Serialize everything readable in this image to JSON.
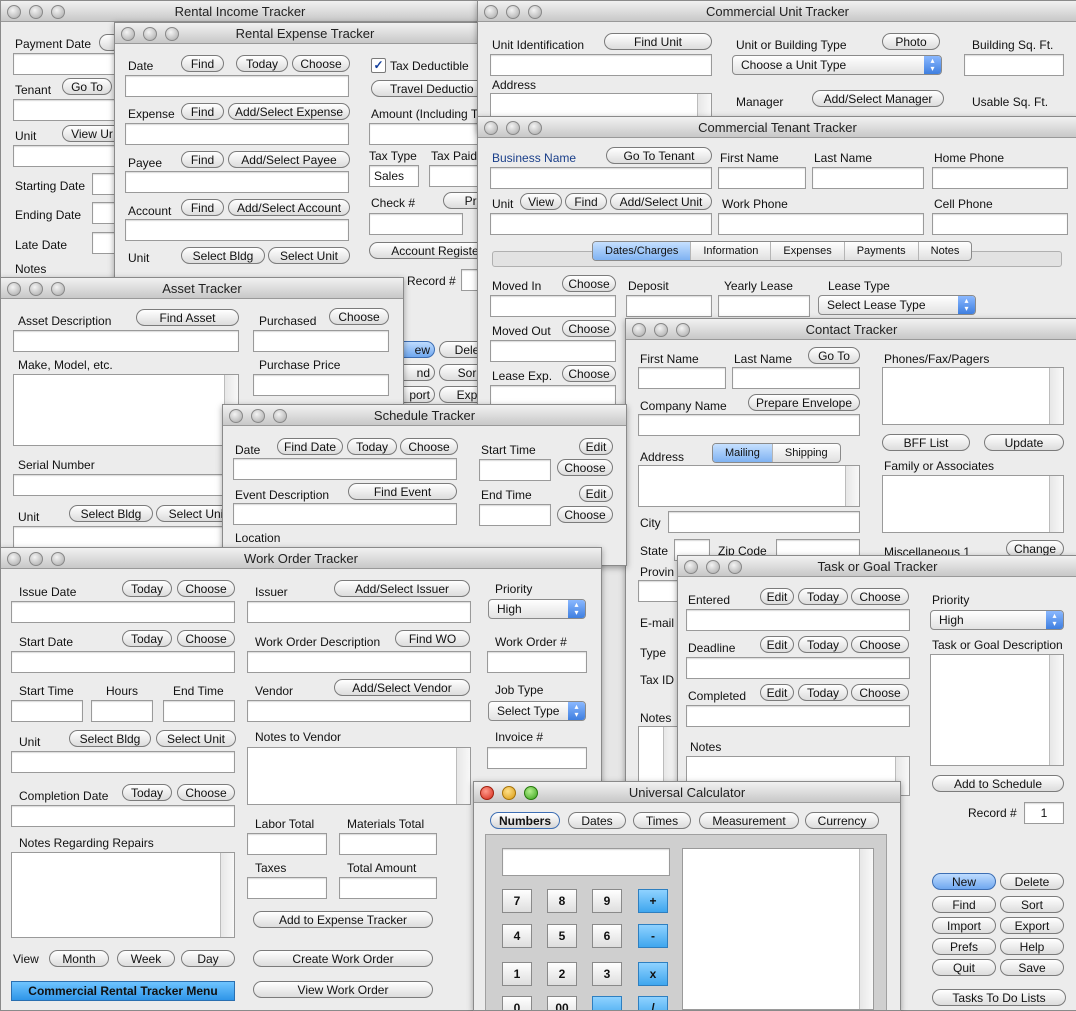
{
  "rental_income": {
    "title": "Rental Income Tracker",
    "payment_date": "Payment Date",
    "tenant": "Tenant",
    "go_to": "Go To",
    "unit": "Unit",
    "view_unit": "View Ur",
    "starting_date": "Starting Date",
    "ending_date": "Ending Date",
    "late_date": "Late Date",
    "notes": "Notes"
  },
  "rental_expense": {
    "title": "Rental Expense Tracker",
    "date": "Date",
    "find": "Find",
    "today": "Today",
    "choose": "Choose",
    "tax_deductible": "Tax Deductible",
    "travel_deduction": "Travel Deductio",
    "expense": "Expense",
    "add_select_expense": "Add/Select Expense",
    "amount": "Amount (Including T",
    "payee": "Payee",
    "add_select_payee": "Add/Select Payee",
    "tax_type": "Tax Type",
    "tax_paid": "Tax Paid",
    "tax_type_value": "Sales",
    "account": "Account",
    "add_select_account": "Add/Select Account",
    "check_no": "Check #",
    "print": "Pri",
    "unit": "Unit",
    "select_bldg": "Select Bldg",
    "select_unit": "Select Unit",
    "account_register": "Account Registe",
    "record_no": "Record #",
    "view": "ew",
    "delete": "Dele",
    "find2": "nd",
    "sort": "Sor",
    "import": "port",
    "export": "Exp"
  },
  "asset": {
    "title": "Asset Tracker",
    "asset_description": "Asset Description",
    "find_asset": "Find Asset",
    "purchased": "Purchased",
    "choose": "Choose",
    "make_model": "Make, Model, etc.",
    "purchase_price": "Purchase Price",
    "serial_number": "Serial Number",
    "unit": "Unit",
    "select_bldg": "Select Bldg",
    "select_unit": "Select Uni"
  },
  "schedule": {
    "title": "Schedule Tracker",
    "date": "Date",
    "find_date": "Find Date",
    "today": "Today",
    "choose": "Choose",
    "start_time": "Start Time",
    "edit": "Edit",
    "event_description": "Event Description",
    "find_event": "Find Event",
    "end_time": "End Time",
    "location": "Location"
  },
  "work_order": {
    "title": "Work Order Tracker",
    "issue_date": "Issue Date",
    "today": "Today",
    "choose": "Choose",
    "issuer": "Issuer",
    "add_select_issuer": "Add/Select Issuer",
    "priority": "Priority",
    "priority_value": "High",
    "start_date": "Start Date",
    "work_order_description": "Work Order Description",
    "find_wo": "Find WO",
    "work_order_no": "Work Order #",
    "start_time": "Start Time",
    "hours": "Hours",
    "end_time": "End Time",
    "vendor": "Vendor",
    "add_select_vendor": "Add/Select Vendor",
    "job_type": "Job Type",
    "select_type": "Select Type",
    "unit": "Unit",
    "select_bldg": "Select Bldg",
    "select_unit": "Select Unit",
    "notes_to_vendor": "Notes to Vendor",
    "invoice_no": "Invoice #",
    "completion_date": "Completion Date",
    "labor_total": "Labor Total",
    "materials_total": "Materials Total",
    "notes_regarding_repairs": "Notes Regarding Repairs",
    "taxes": "Taxes",
    "total_amount": "Total Amount",
    "add_to_expense": "Add to Expense Tracker",
    "view": "View",
    "month": "Month",
    "week": "Week",
    "day": "Day",
    "create_work_order": "Create Work Order",
    "menu": "Commercial Rental Tracker Menu",
    "view_work_order": "View Work Order"
  },
  "commercial_unit": {
    "title": "Commercial Unit Tracker",
    "unit_identification": "Unit Identification",
    "find_unit": "Find Unit",
    "unit_building_type": "Unit or Building Type",
    "photo": "Photo",
    "building_sqft": "Building Sq. Ft.",
    "unit_type_value": "Choose a Unit Type",
    "address": "Address",
    "manager": "Manager",
    "add_select_manager": "Add/Select Manager",
    "usable_sqft": "Usable Sq. Ft."
  },
  "commercial_tenant": {
    "title": "Commercial Tenant Tracker",
    "business_name": "Business Name",
    "go_to_tenant": "Go To Tenant",
    "first_name": "First Name",
    "last_name": "Last Name",
    "home_phone": "Home Phone",
    "unit": "Unit",
    "view": "View",
    "find": "Find",
    "add_select_unit": "Add/Select Unit",
    "work_phone": "Work Phone",
    "cell_phone": "Cell Phone",
    "tabs": [
      "Dates/Charges",
      "Information",
      "Expenses",
      "Payments",
      "Notes"
    ],
    "moved_in": "Moved In",
    "choose": "Choose",
    "deposit": "Deposit",
    "yearly_lease": "Yearly Lease",
    "lease_type": "Lease Type",
    "lease_type_value": "Select Lease Type",
    "moved_out": "Moved Out",
    "lease_exp": "Lease Exp."
  },
  "contact": {
    "title": "Contact Tracker",
    "first_name": "First Name",
    "last_name": "Last Name",
    "go_to": "Go To",
    "phones": "Phones/Fax/Pagers",
    "company_name": "Company Name",
    "prepare_envelope": "Prepare Envelope",
    "bff_list": "BFF List",
    "update": "Update",
    "address": "Address",
    "mailing": "Mailing",
    "shipping": "Shipping",
    "family": "Family or Associates",
    "city": "City",
    "state": "State",
    "zip_code": "Zip Code",
    "misc1": "Miscellaneous 1",
    "change": "Change",
    "province": "Provin",
    "email": "E-mail",
    "type": "Type",
    "tax_id": "Tax ID",
    "notes": "Notes"
  },
  "task": {
    "title": "Task or Goal Tracker",
    "entered": "Entered",
    "edit": "Edit",
    "today": "Today",
    "choose": "Choose",
    "priority": "Priority",
    "priority_value": "High",
    "deadline": "Deadline",
    "task_description": "Task or Goal Description",
    "completed": "Completed",
    "notes": "Notes",
    "add_to_schedule": "Add to Schedule",
    "record_no": "Record #",
    "record_value": "1",
    "new": "New",
    "delete": "Delete",
    "find": "Find",
    "sort": "Sort",
    "import": "Import",
    "export": "Export",
    "prefs": "Prefs",
    "help": "Help",
    "quit": "Quit",
    "save": "Save",
    "tasks_to_do": "Tasks To Do Lists"
  },
  "calculator": {
    "title": "Universal Calculator",
    "tabs": [
      "Numbers",
      "Dates",
      "Times",
      "Measurement",
      "Currency"
    ],
    "keys": [
      "7",
      "8",
      "9",
      "+",
      "4",
      "5",
      "6",
      "-",
      "1",
      "2",
      "3",
      "x",
      "0",
      "00",
      "",
      "/"
    ]
  }
}
